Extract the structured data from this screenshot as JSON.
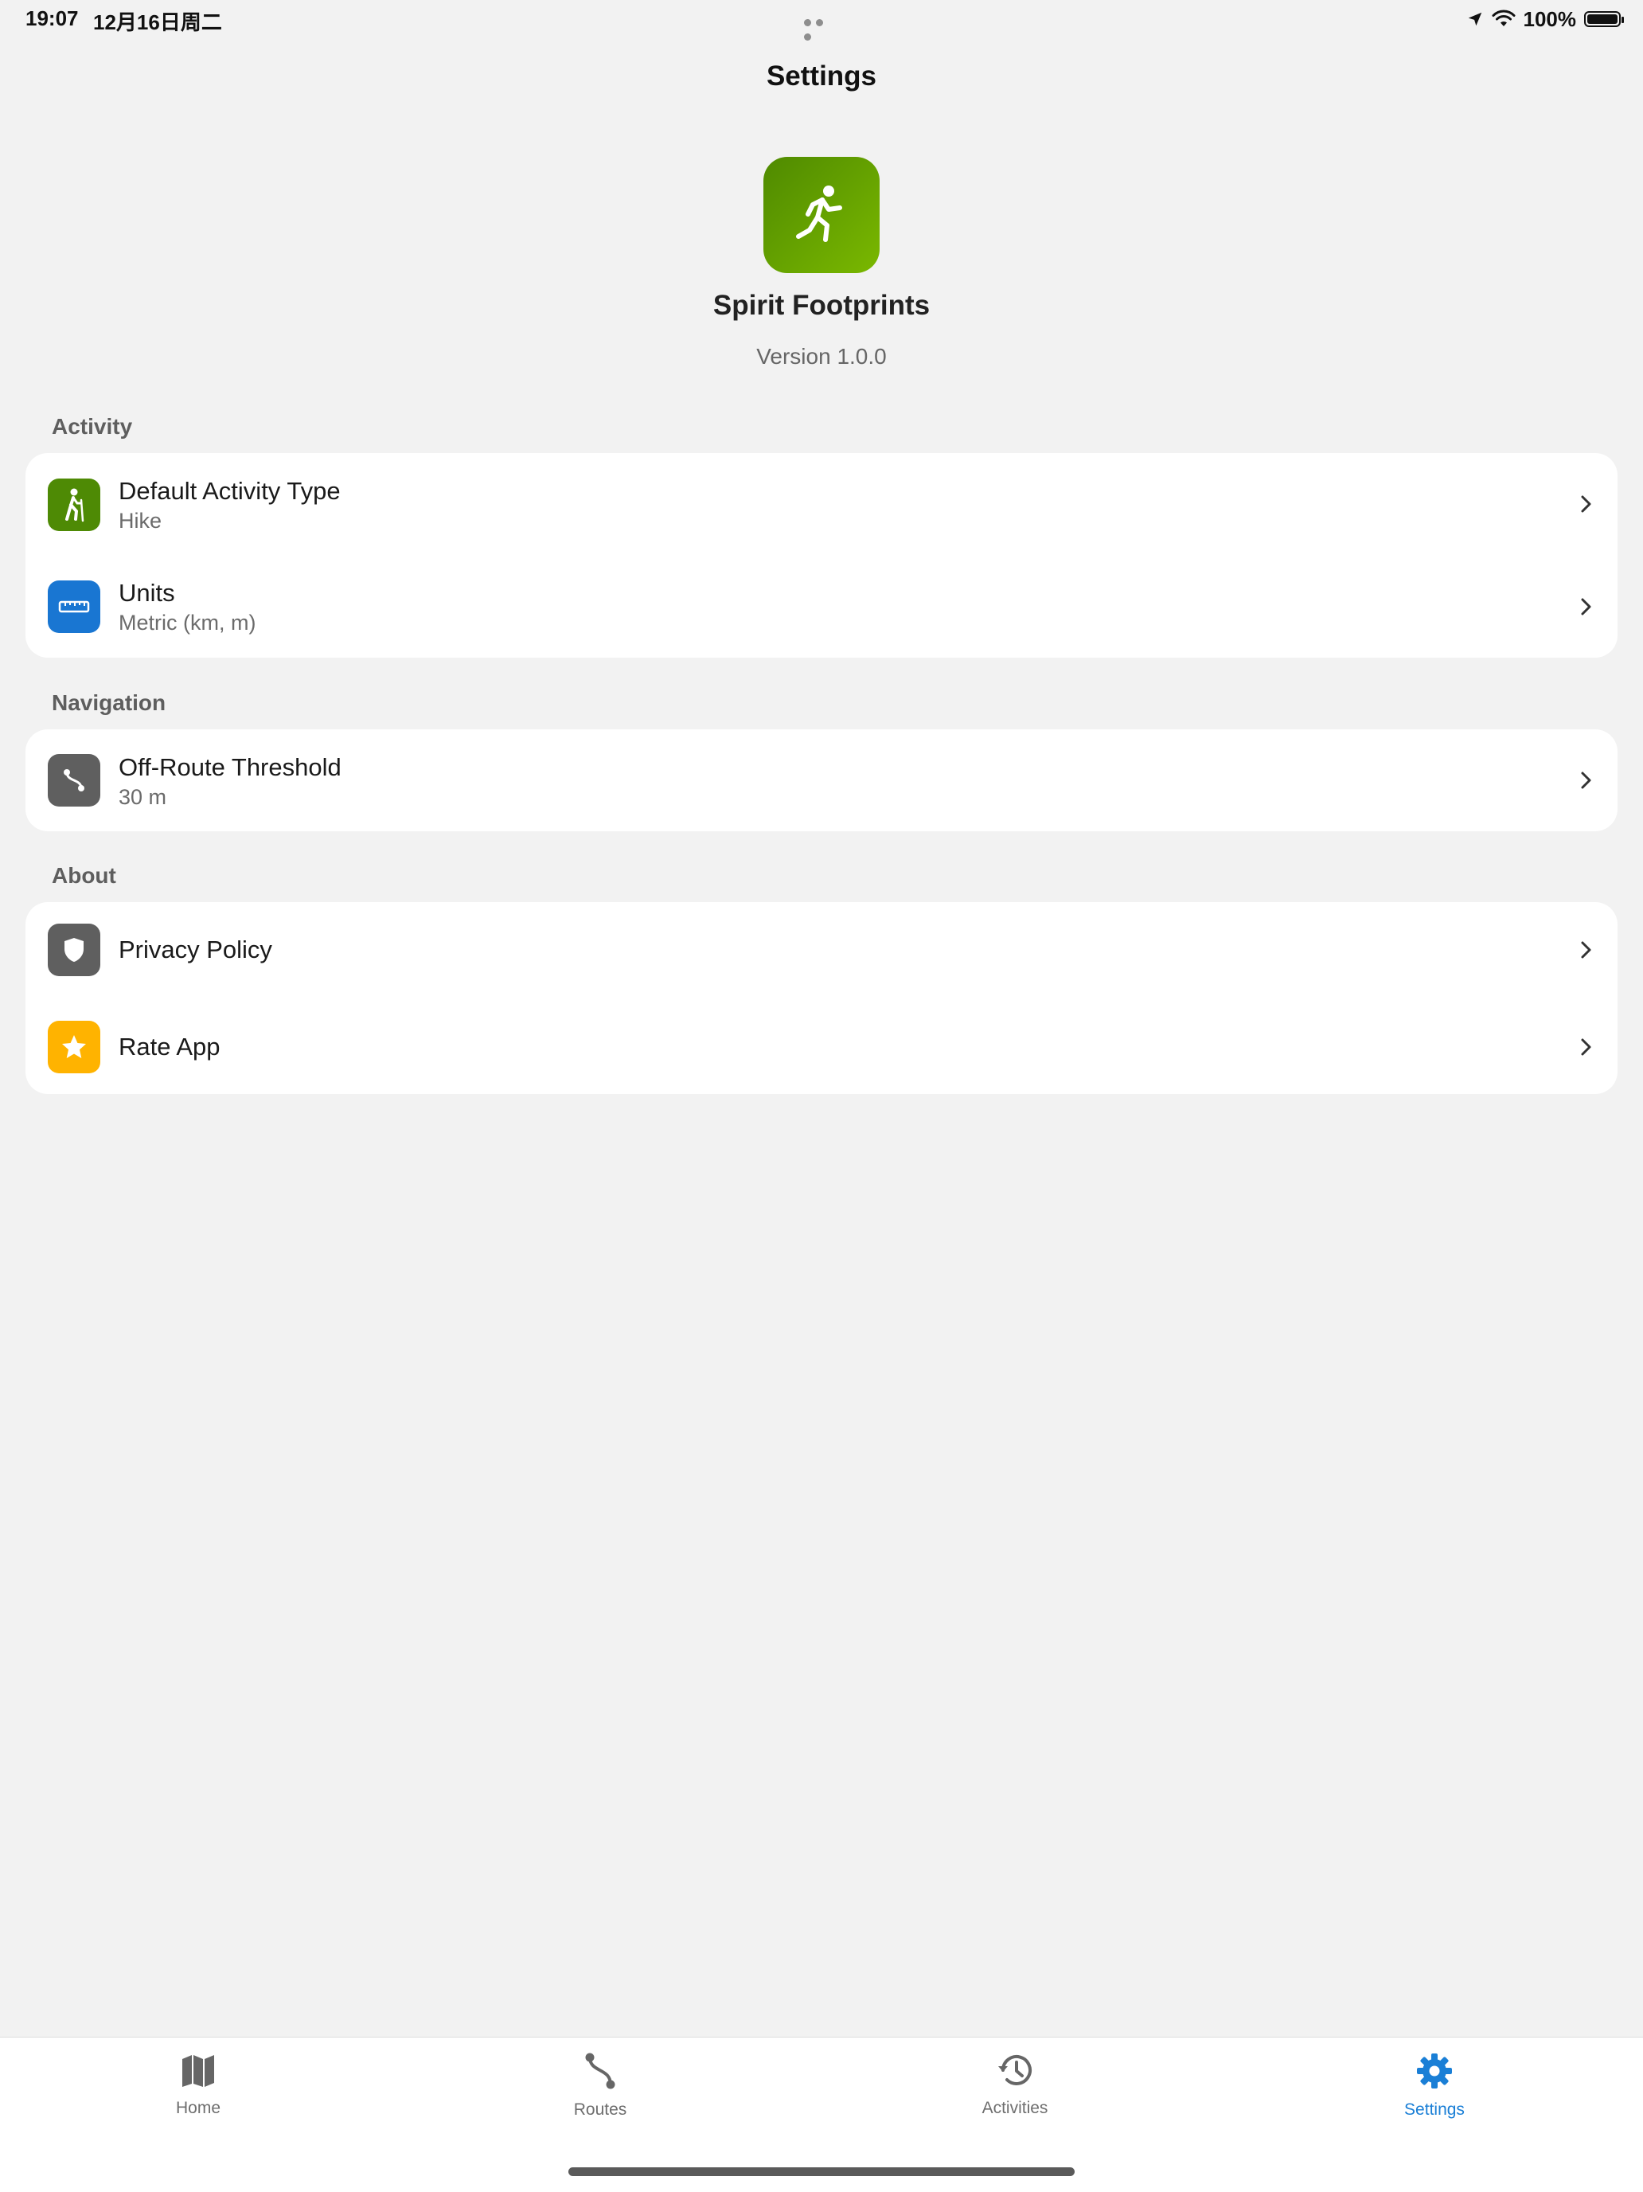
{
  "status_bar": {
    "time": "19:07",
    "date": "12月16日周二",
    "battery": "100%"
  },
  "header": {
    "title": "Settings"
  },
  "app": {
    "name": "Spirit Footprints",
    "version": "Version 1.0.0"
  },
  "sections": {
    "activity": {
      "title": "Activity",
      "rows": [
        {
          "title": "Default Activity Type",
          "subtitle": "Hike",
          "icon": "hiking-icon",
          "color": "#4e8a05"
        },
        {
          "title": "Units",
          "subtitle": "Metric (km, m)",
          "icon": "ruler-icon",
          "color": "#1976d2"
        }
      ]
    },
    "navigation": {
      "title": "Navigation",
      "rows": [
        {
          "title": "Off-Route Threshold",
          "subtitle": "30 m",
          "icon": "route-icon",
          "color": "#5f5f5f"
        }
      ]
    },
    "about": {
      "title": "About",
      "rows": [
        {
          "title": "Privacy Policy",
          "icon": "shield-icon",
          "color": "#5f5f5f"
        },
        {
          "title": "Rate App",
          "icon": "star-icon",
          "color": "#ffb300"
        }
      ]
    }
  },
  "tabs": [
    {
      "label": "Home",
      "icon": "map-icon",
      "active": false
    },
    {
      "label": "Routes",
      "icon": "route-icon",
      "active": false
    },
    {
      "label": "Activities",
      "icon": "history-icon",
      "active": false
    },
    {
      "label": "Settings",
      "icon": "gear-icon",
      "active": true
    }
  ],
  "colors": {
    "background": "#f2f2f2",
    "accent": "#1a7fd6",
    "card": "#ffffff"
  }
}
